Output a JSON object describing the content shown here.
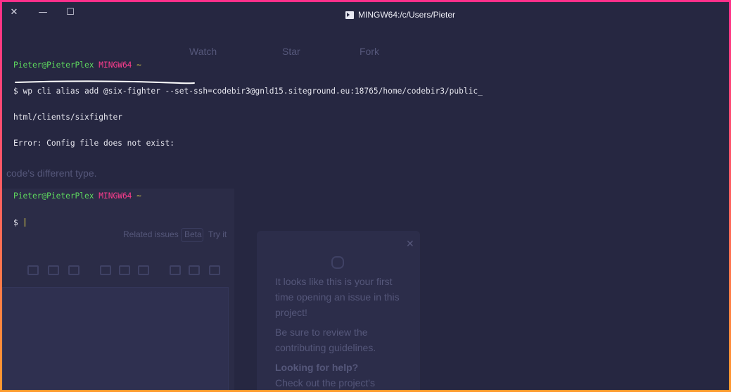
{
  "window": {
    "title": "MINGW64:/c/Users/Pieter",
    "controls": {
      "close_glyph": "✕",
      "minimize_glyph": "—",
      "maximize_glyph": "☐"
    }
  },
  "terminal": {
    "prompt1": {
      "user": "Pieter@PieterPlex",
      "host": "MINGW64",
      "path": "~"
    },
    "command": "$ wp cli alias add @six-fighter --set-ssh=codebir3@gnld15.siteground.eu:18765/home/codebir3/public_",
    "command_wrap": "html/clients/sixfighter",
    "error": "Error: Config file does not exist:",
    "prompt2": {
      "user": "Pieter@PieterPlex",
      "host": "MINGW64",
      "path": "~"
    },
    "input_prompt": "$ "
  },
  "background_page": {
    "watch": "Watch",
    "star": "Star",
    "fork": "Fork",
    "type_hint": "code's different type.",
    "related_issues": "Related issues",
    "beta": "Beta",
    "try_it": "Try it",
    "tip_close": "✕",
    "tip_text_1": "It looks like this is your first",
    "tip_text_2": "time opening an issue in this",
    "tip_text_3": "project!",
    "tip_text_4": "Be sure to review the",
    "tip_text_5": "contributing guidelines.",
    "tip_heading": "Looking for help?",
    "tip_text_6": "Check out the project's"
  },
  "colors": {
    "terminal_bg": "#262741",
    "user_green": "#5fdc5f",
    "host_pink": "#ff3d8e",
    "path_yellow": "#e5d84a",
    "border_gradient": [
      "#ff2f8a",
      "#ff9a2e"
    ]
  }
}
